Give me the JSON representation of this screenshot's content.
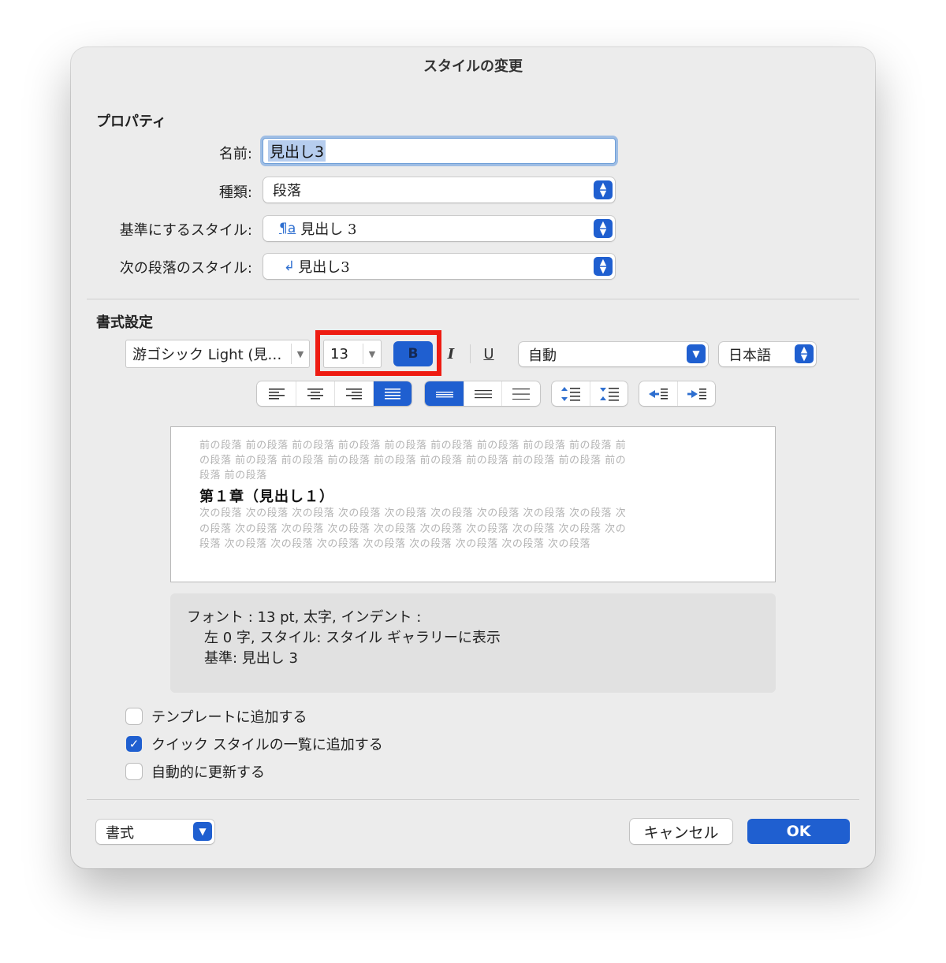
{
  "dialog": {
    "title": "スタイルの変更",
    "properties": {
      "heading": "プロパティ",
      "name_label": "名前:",
      "name_value": "見出し3",
      "type_label": "種類:",
      "type_value": "段落",
      "based_on_label": "基準にするスタイル:",
      "based_on_icon_text": "¶a",
      "based_on_value": "見出し 3",
      "next_label": "次の段落のスタイル:",
      "next_icon_text": "↲",
      "next_value": "見出し3"
    },
    "formatting": {
      "heading": "書式設定",
      "font_name": "游ゴシック Light (見…",
      "font_size": "13",
      "bold_label": "B",
      "italic_label": "I",
      "underline_label": "U",
      "color_value": "自動",
      "language_value": "日本語",
      "alignment_selected": "justify",
      "line_spacing_selected": "single"
    },
    "preview": {
      "prev_line1": "前の段落 前の段落 前の段落 前の段落 前の段落 前の段落 前の段落 前の段落 前の段落 前",
      "prev_line2": "の段落 前の段落 前の段落 前の段落 前の段落 前の段落 前の段落 前の段落 前の段落 前の",
      "prev_line3": "段落 前の段落",
      "heading": "第１章（見出し１）",
      "next_line1": "次の段落 次の段落 次の段落 次の段落 次の段落 次の段落 次の段落 次の段落 次の段落 次",
      "next_line2": "の段落 次の段落 次の段落 次の段落 次の段落 次の段落 次の段落 次の段落 次の段落 次の",
      "next_line3": "段落 次の段落 次の段落 次の段落 次の段落 次の段落 次の段落 次の段落 次の段落"
    },
    "description": {
      "line1": "フォント : 13 pt, 太字, インデント :",
      "line2": "左  0 字, スタイル: スタイル ギャラリーに表示",
      "line3": "基準: 見出し 3"
    },
    "options": {
      "add_to_template": {
        "label": "テンプレートに追加する",
        "checked": false
      },
      "quick_styles": {
        "label": "クイック スタイルの一覧に追加する",
        "checked": true
      },
      "auto_update": {
        "label": "自動的に更新する",
        "checked": false
      }
    },
    "footer": {
      "format_label": "書式",
      "cancel_label": "キャンセル",
      "ok_label": "OK"
    },
    "colors": {
      "accent": "#1f5fd0",
      "highlight": "#ee1c12"
    }
  }
}
